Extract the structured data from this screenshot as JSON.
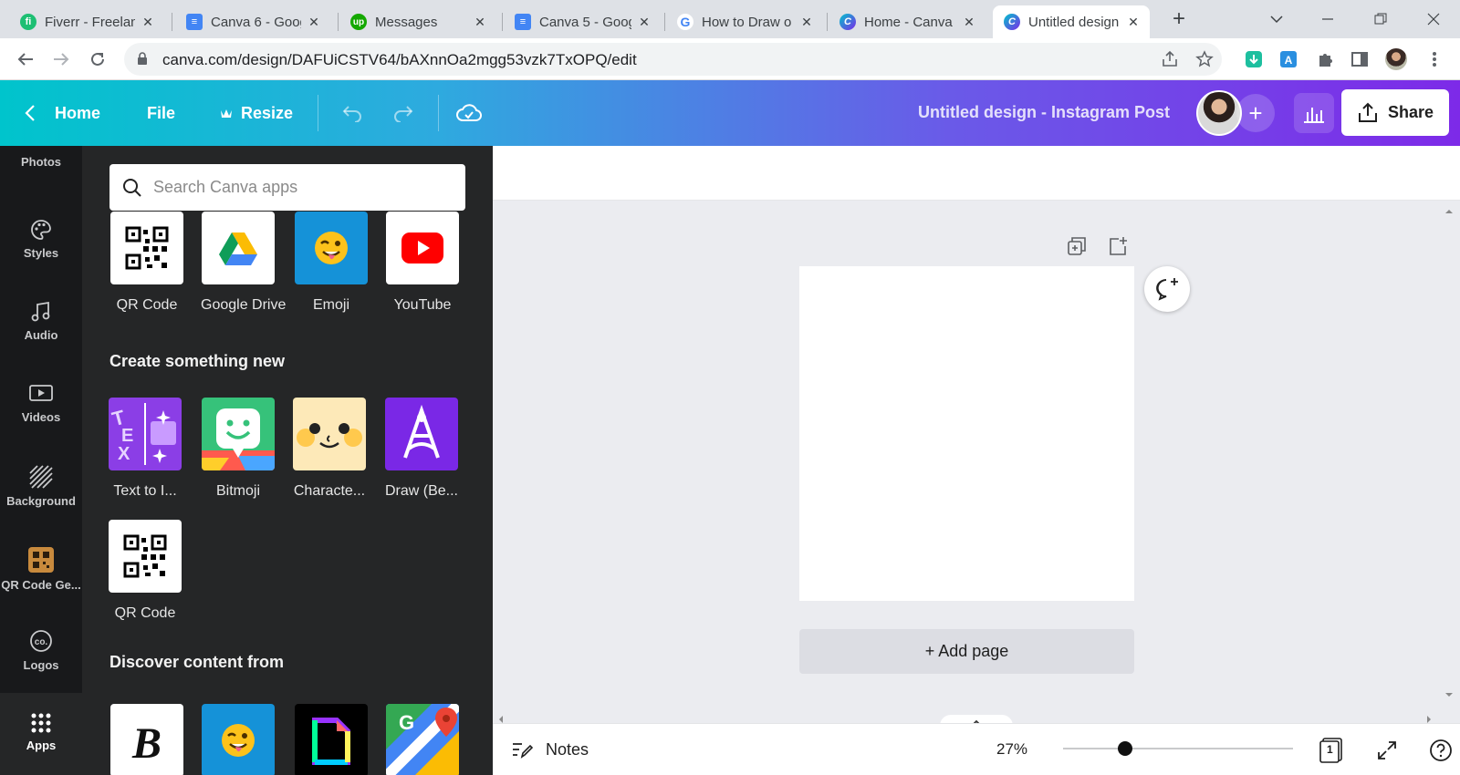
{
  "browser": {
    "tabs": [
      {
        "title": "Fiverr - Freelan",
        "icon": "fiverr-icon",
        "color": "#1dbf73",
        "glyph": "fi"
      },
      {
        "title": "Canva 6 - Goog",
        "icon": "google-docs-icon",
        "color": "#4285f4",
        "glyph": ""
      },
      {
        "title": "Messages",
        "icon": "upwork-icon",
        "color": "#14a800",
        "glyph": "up"
      },
      {
        "title": "Canva 5 - Goog",
        "icon": "google-docs-icon",
        "color": "#4285f4",
        "glyph": ""
      },
      {
        "title": "How to Draw o",
        "icon": "google-icon",
        "color": "#ffffff",
        "glyph": "G"
      },
      {
        "title": "Home - Canva",
        "icon": "canva-icon",
        "color": "#00c4cc",
        "glyph": "C"
      },
      {
        "title": "Untitled design",
        "icon": "canva-icon",
        "color": "#7d2ae8",
        "glyph": "C",
        "active": true
      }
    ],
    "url": "canva.com/design/DAFUiCSTV64/bAXnnOa2mgg53vzk7TxOPQ/edit"
  },
  "header": {
    "home": "Home",
    "file": "File",
    "resize": "Resize",
    "design_title": "Untitled design - Instagram Post",
    "share": "Share"
  },
  "rail": {
    "items": [
      {
        "label": "Photos",
        "icon": "photos-icon"
      },
      {
        "label": "Styles",
        "icon": "palette-icon"
      },
      {
        "label": "Audio",
        "icon": "music-note-icon"
      },
      {
        "label": "Videos",
        "icon": "video-icon"
      },
      {
        "label": "Background",
        "icon": "background-hatch-icon"
      },
      {
        "label": "QR Code Ge...",
        "icon": "qr-code-app-icon"
      },
      {
        "label": "Logos",
        "icon": "logos-icon"
      },
      {
        "label": "Apps",
        "icon": "apps-grid-icon"
      }
    ]
  },
  "panel": {
    "search_placeholder": "Search Canva apps",
    "top_apps": [
      "QR Code",
      "Google Drive",
      "Emoji",
      "YouTube"
    ],
    "create_header": "Create something new",
    "create_apps": [
      "Text to I...",
      "Bitmoji",
      "Characte...",
      "Draw (Be...",
      "QR Code"
    ],
    "discover_header": "Discover content from"
  },
  "canvas": {
    "add_page": "+ Add page"
  },
  "footer": {
    "notes": "Notes",
    "zoom": "27%",
    "zoom_level": 0.27,
    "page_count": "1"
  },
  "colors": {
    "accent_teal": "#00c4cc",
    "accent_purple": "#7d2ae8",
    "panel_bg": "#252627",
    "rail_bg": "#18191b"
  }
}
